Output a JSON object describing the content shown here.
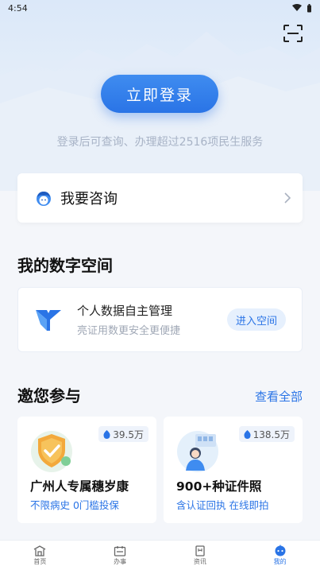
{
  "status_bar": {
    "time": "4:54"
  },
  "login": {
    "button_label": "立即登录",
    "hint": "登录后可查询、办理超过2516项民生服务"
  },
  "consult": {
    "label": "我要咨询"
  },
  "digital_space": {
    "section_title": "我的数字空间",
    "title": "个人数据自主管理",
    "subtitle": "亮证用数更安全更便捷",
    "enter_label": "进入空间"
  },
  "participate": {
    "section_title": "邀您参与",
    "see_all": "查看全部",
    "cards": [
      {
        "count": "39.5万",
        "title": "广州人专属穗岁康",
        "subtitle": "不限病史 0门槛投保"
      },
      {
        "count": "138.5万",
        "title": "900+种证件照",
        "subtitle": "含认证回执 在线即拍"
      }
    ]
  },
  "bottom_nav": {
    "items": [
      {
        "label": "首页",
        "icon": "home-icon"
      },
      {
        "label": "办事",
        "icon": "calendar-icon"
      },
      {
        "label": "资讯",
        "icon": "news-icon"
      },
      {
        "label": "我的",
        "icon": "robot-icon",
        "active": true
      }
    ]
  },
  "colors": {
    "accent": "#2a74e6",
    "background": "#f4f6fa"
  }
}
